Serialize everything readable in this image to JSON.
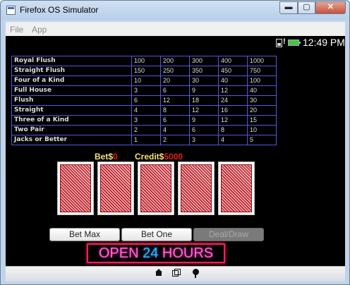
{
  "window": {
    "title": "Firefox OS Simulator",
    "min_glyph": "▬",
    "max_glyph": "▢",
    "close_glyph": "✕"
  },
  "menu": [
    {
      "label": "File"
    },
    {
      "label": "App"
    }
  ],
  "status": {
    "time": "12:49 PM",
    "signal_alert": "!"
  },
  "paytable": [
    {
      "hand": "Royal Flush",
      "payouts": [
        "100",
        "200",
        "300",
        "400",
        "1000"
      ]
    },
    {
      "hand": "Straight Flush",
      "payouts": [
        "150",
        "250",
        "350",
        "450",
        "750"
      ]
    },
    {
      "hand": "Four of a Kind",
      "payouts": [
        "10",
        "20",
        "30",
        "40",
        "100"
      ]
    },
    {
      "hand": "Full House",
      "payouts": [
        "3",
        "6",
        "9",
        "12",
        "40"
      ]
    },
    {
      "hand": "Flush",
      "payouts": [
        "6",
        "12",
        "18",
        "24",
        "30"
      ]
    },
    {
      "hand": "Straight",
      "payouts": [
        "4",
        "8",
        "12",
        "16",
        "20"
      ]
    },
    {
      "hand": "Three of a Kind",
      "payouts": [
        "3",
        "6",
        "9",
        "12",
        "15"
      ]
    },
    {
      "hand": "Two Pair",
      "payouts": [
        "2",
        "4",
        "6",
        "8",
        "10"
      ]
    },
    {
      "hand": "Jacks or Better",
      "payouts": [
        "1",
        "2",
        "3",
        "4",
        "5"
      ]
    }
  ],
  "bet": {
    "label": "Bet$",
    "value": "0"
  },
  "credit": {
    "label": "Credit$",
    "value": "5000"
  },
  "cards": [
    "card-back",
    "card-back",
    "card-back",
    "card-back",
    "card-back"
  ],
  "buttons": {
    "bet_max": "Bet Max",
    "bet_one": "Bet One",
    "deal_draw": "Deal/Draw",
    "deal_draw_enabled": false
  },
  "sign": {
    "part1": "OPEN ",
    "part2": "24",
    "part3": " HOURS"
  },
  "colors": {
    "screen_bg": "#000000",
    "table_border": "#5555dd",
    "bet_label": "#f2e27a",
    "bet_value": "#e0201f",
    "neon_frame": "#ff1f5a",
    "neon_pink": "#ff66d0",
    "neon_blue": "#2fb8ff"
  },
  "nav_icons": [
    "home-icon",
    "windows-icon",
    "location-pin-icon"
  ]
}
